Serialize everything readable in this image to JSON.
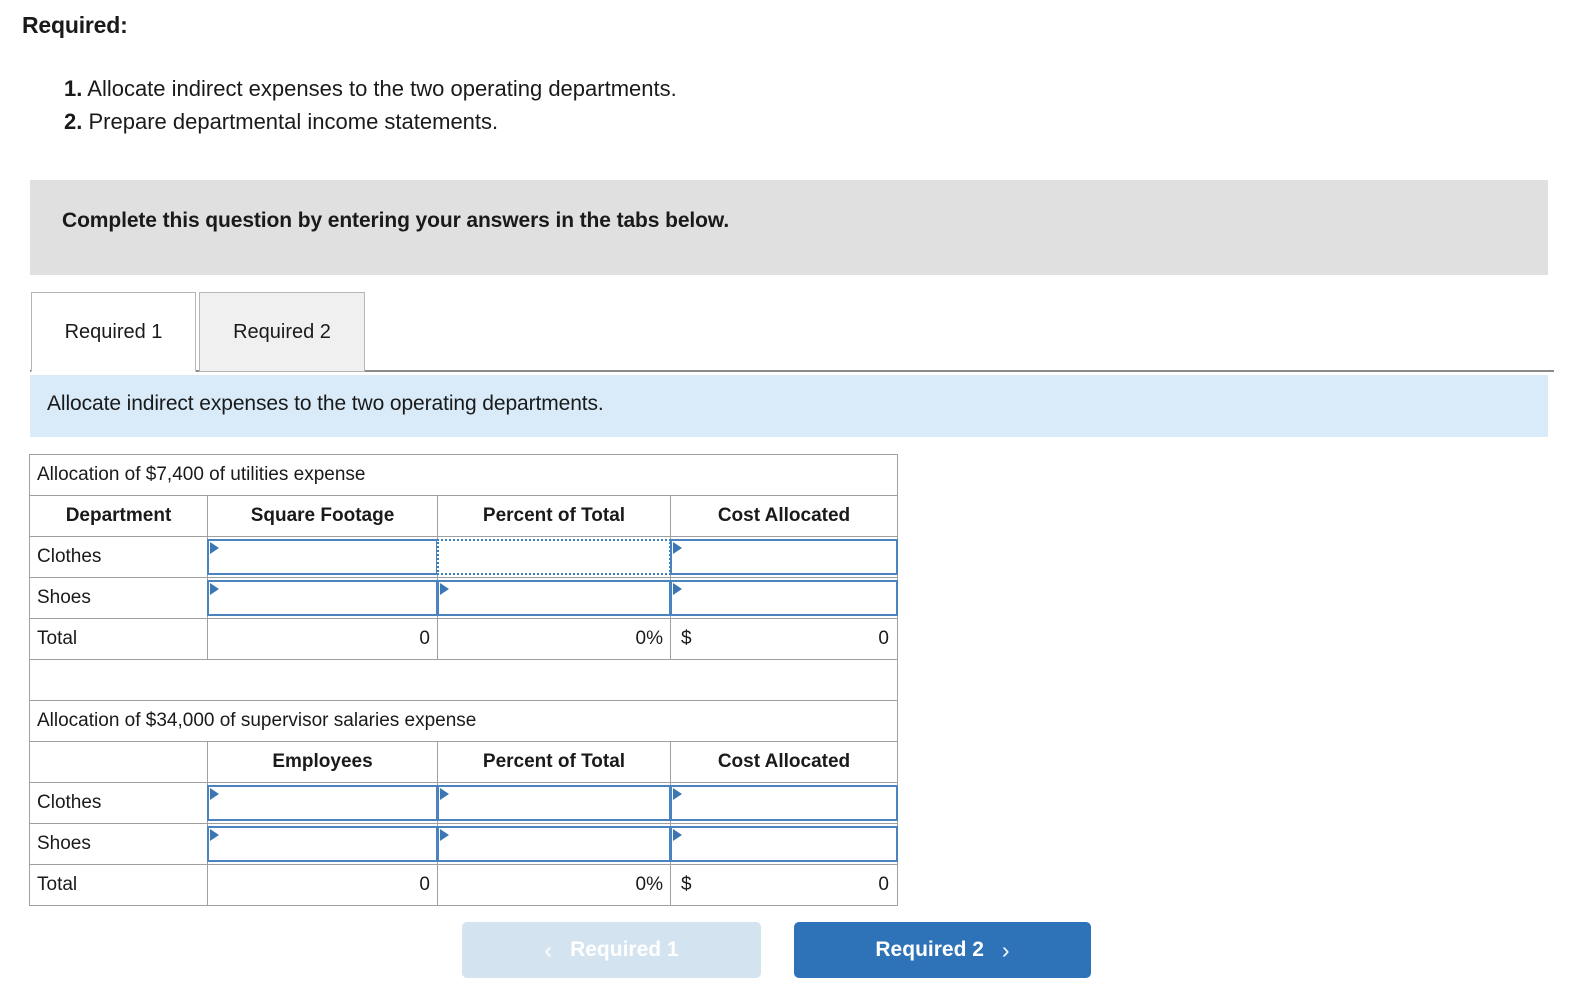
{
  "required": {
    "heading": "Required:",
    "items": [
      {
        "num": "1.",
        "text": "Allocate indirect expenses to the two operating departments."
      },
      {
        "num": "2.",
        "text": "Prepare departmental income statements."
      }
    ]
  },
  "banner": {
    "text": "Complete this question by entering your answers in the tabs below."
  },
  "tabs": [
    {
      "label": "Required 1",
      "active": true
    },
    {
      "label": "Required 2",
      "active": false
    }
  ],
  "sub_instruction": {
    "text": "Allocate indirect expenses to the two operating departments."
  },
  "table1": {
    "title": "Allocation of $7,400 of utilities expense",
    "headers": [
      "Department",
      "Square Footage",
      "Percent of Total",
      "Cost Allocated"
    ],
    "rows": [
      {
        "label": "Clothes",
        "amount": "",
        "percent": "",
        "cost": ""
      },
      {
        "label": "Shoes",
        "amount": "",
        "percent": "",
        "cost": ""
      }
    ],
    "total": {
      "label": "Total",
      "amount": "0",
      "percent": "0%",
      "cost_symbol": "$",
      "cost_value": "0"
    }
  },
  "table2": {
    "title": "Allocation of $34,000 of supervisor salaries expense",
    "headers": [
      "",
      "Employees",
      "Percent of Total",
      "Cost Allocated"
    ],
    "rows": [
      {
        "label": "Clothes",
        "amount": "",
        "percent": "",
        "cost": ""
      },
      {
        "label": "Shoes",
        "amount": "",
        "percent": "",
        "cost": ""
      }
    ],
    "total": {
      "label": "Total",
      "amount": "0",
      "percent": "0%",
      "cost_symbol": "$",
      "cost_value": "0"
    }
  },
  "nav": {
    "prev_label": "Required 1",
    "prev_icon": "chevron-left-icon",
    "prev_glyph": "‹",
    "next_label": "Required 2",
    "next_icon": "chevron-right-icon",
    "next_glyph": "›"
  },
  "colors": {
    "header_blue": "#7bafdd",
    "instruction_blue": "#d9ebf9",
    "banner_grey": "#e0e0e0",
    "primary_button": "#2e73b8",
    "disabled_button": "#d4e3f0",
    "entry_border": "#4a83bd"
  }
}
